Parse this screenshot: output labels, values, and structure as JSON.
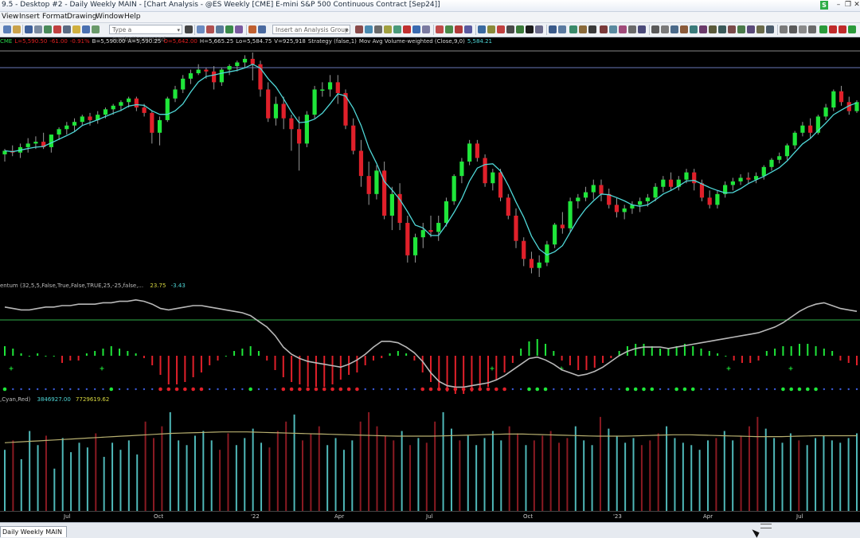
{
  "window": {
    "title": "9.5 - Desktop #2 - Daily Weekly MAIN - [Chart Analysis - @ES Weekly [CME] E-mini S&P 500 Continuous Contract [Sep24]]",
    "badge": "S",
    "minimize_glyph": "–",
    "restore_glyph": "❐",
    "close_glyph": "✕"
  },
  "menu": [
    "View",
    "Insert",
    "Format",
    "Drawing",
    "Window",
    "Help"
  ],
  "toolbar": {
    "command_placeholder": "Type a symbol/command",
    "analysis_group_placeholder": "Insert an Analysis Group",
    "dropdown_glyph": "▾"
  },
  "symbol_bar": {
    "exchange": "CME",
    "last": "L=5,590.50",
    "change": "-61.00",
    "percent": "-0.91%",
    "bid": "B=5,590.00",
    "ask": "A=5,590.25",
    "open": "O=5,642.00",
    "high": "H=5,665.25",
    "low": "Lo=5,584.75",
    "volume": "V=925,918",
    "strategy": "Strategy (false,1)",
    "ma_label": "Mov Avg Volume-weighted (Close,9,0)",
    "ma_value": "5,584.21"
  },
  "indicator": {
    "label": "entum (32,5,5,False,True,False,TRUE,25,-25,false,...",
    "value1": "23.75",
    "value2": "-3.43"
  },
  "volume_indicator": {
    "label": ",Cyan,Red)",
    "value1": "3846927.00",
    "value2": "7729619.62"
  },
  "x_axis": [
    "Jul",
    "Oct",
    "'22",
    "Apr",
    "Jul",
    "Oct",
    "'23",
    "Apr",
    "Jul"
  ],
  "tabs": [
    "Daily Weekly MAIN"
  ],
  "colors": {
    "up": "#1fe63a",
    "down": "#e0202a",
    "ma_line": "#4fd8d8",
    "momentum_line": "#b8b8b8",
    "zero_line": "#2fae48",
    "volume_up": "#4fb8b8",
    "volume_down": "#8a1a22",
    "volume_avg": "#b8b070"
  },
  "chart_data": {
    "type": "candlestick",
    "description_series": "ES weekly OHLC approximation (index units)",
    "candles": [
      {
        "o": 4240,
        "h": 4270,
        "l": 4200,
        "c": 4260
      },
      {
        "o": 4260,
        "h": 4290,
        "l": 4230,
        "c": 4250
      },
      {
        "o": 4250,
        "h": 4300,
        "l": 4220,
        "c": 4280
      },
      {
        "o": 4280,
        "h": 4330,
        "l": 4250,
        "c": 4300
      },
      {
        "o": 4300,
        "h": 4340,
        "l": 4270,
        "c": 4310
      },
      {
        "o": 4310,
        "h": 4360,
        "l": 4270,
        "c": 4280
      },
      {
        "o": 4280,
        "h": 4320,
        "l": 4250,
        "c": 4350
      },
      {
        "o": 4350,
        "h": 4390,
        "l": 4320,
        "c": 4380
      },
      {
        "o": 4380,
        "h": 4420,
        "l": 4350,
        "c": 4400
      },
      {
        "o": 4400,
        "h": 4440,
        "l": 4370,
        "c": 4420
      },
      {
        "o": 4420,
        "h": 4460,
        "l": 4400,
        "c": 4450
      },
      {
        "o": 4450,
        "h": 4470,
        "l": 4400,
        "c": 4430
      },
      {
        "o": 4430,
        "h": 4480,
        "l": 4410,
        "c": 4460
      },
      {
        "o": 4460,
        "h": 4500,
        "l": 4440,
        "c": 4490
      },
      {
        "o": 4490,
        "h": 4520,
        "l": 4460,
        "c": 4510
      },
      {
        "o": 4510,
        "h": 4540,
        "l": 4480,
        "c": 4530
      },
      {
        "o": 4530,
        "h": 4560,
        "l": 4500,
        "c": 4550
      },
      {
        "o": 4550,
        "h": 4560,
        "l": 4480,
        "c": 4500
      },
      {
        "o": 4500,
        "h": 4520,
        "l": 4450,
        "c": 4470
      },
      {
        "o": 4470,
        "h": 4480,
        "l": 4300,
        "c": 4360
      },
      {
        "o": 4360,
        "h": 4450,
        "l": 4290,
        "c": 4430
      },
      {
        "o": 4430,
        "h": 4560,
        "l": 4420,
        "c": 4550
      },
      {
        "o": 4550,
        "h": 4620,
        "l": 4530,
        "c": 4600
      },
      {
        "o": 4600,
        "h": 4680,
        "l": 4580,
        "c": 4660
      },
      {
        "o": 4660,
        "h": 4710,
        "l": 4630,
        "c": 4690
      },
      {
        "o": 4690,
        "h": 4740,
        "l": 4680,
        "c": 4710
      },
      {
        "o": 4710,
        "h": 4720,
        "l": 4660,
        "c": 4700
      },
      {
        "o": 4700,
        "h": 4730,
        "l": 4600,
        "c": 4640
      },
      {
        "o": 4640,
        "h": 4720,
        "l": 4620,
        "c": 4710
      },
      {
        "o": 4710,
        "h": 4740,
        "l": 4680,
        "c": 4730
      },
      {
        "o": 4730,
        "h": 4760,
        "l": 4700,
        "c": 4750
      },
      {
        "o": 4750,
        "h": 4790,
        "l": 4720,
        "c": 4770
      },
      {
        "o": 4770,
        "h": 4805,
        "l": 4650,
        "c": 4740
      },
      {
        "o": 4740,
        "h": 4760,
        "l": 4560,
        "c": 4600
      },
      {
        "o": 4600,
        "h": 4640,
        "l": 4420,
        "c": 4440
      },
      {
        "o": 4440,
        "h": 4560,
        "l": 4400,
        "c": 4520
      },
      {
        "o": 4520,
        "h": 4560,
        "l": 4380,
        "c": 4440
      },
      {
        "o": 4440,
        "h": 4460,
        "l": 4260,
        "c": 4380
      },
      {
        "o": 4380,
        "h": 4450,
        "l": 4150,
        "c": 4300
      },
      {
        "o": 4300,
        "h": 4480,
        "l": 4280,
        "c": 4460
      },
      {
        "o": 4460,
        "h": 4620,
        "l": 4440,
        "c": 4600
      },
      {
        "o": 4600,
        "h": 4640,
        "l": 4560,
        "c": 4600
      },
      {
        "o": 4600,
        "h": 4680,
        "l": 4560,
        "c": 4640
      },
      {
        "o": 4640,
        "h": 4680,
        "l": 4520,
        "c": 4580
      },
      {
        "o": 4580,
        "h": 4600,
        "l": 4380,
        "c": 4400
      },
      {
        "o": 4400,
        "h": 4440,
        "l": 4240,
        "c": 4260
      },
      {
        "o": 4260,
        "h": 4320,
        "l": 4060,
        "c": 4120
      },
      {
        "o": 4120,
        "h": 4200,
        "l": 3960,
        "c": 4020
      },
      {
        "o": 4020,
        "h": 4180,
        "l": 3990,
        "c": 4150
      },
      {
        "o": 4150,
        "h": 4200,
        "l": 3880,
        "c": 3900
      },
      {
        "o": 3900,
        "h": 4060,
        "l": 3820,
        "c": 4020
      },
      {
        "o": 4020,
        "h": 4080,
        "l": 3820,
        "c": 3860
      },
      {
        "o": 3860,
        "h": 3900,
        "l": 3640,
        "c": 3680
      },
      {
        "o": 3680,
        "h": 3800,
        "l": 3640,
        "c": 3780
      },
      {
        "o": 3780,
        "h": 3860,
        "l": 3720,
        "c": 3820
      },
      {
        "o": 3820,
        "h": 3900,
        "l": 3780,
        "c": 3810
      },
      {
        "o": 3810,
        "h": 3900,
        "l": 3760,
        "c": 3860
      },
      {
        "o": 3860,
        "h": 4000,
        "l": 3840,
        "c": 3980
      },
      {
        "o": 3980,
        "h": 4130,
        "l": 3960,
        "c": 4120
      },
      {
        "o": 4120,
        "h": 4220,
        "l": 4080,
        "c": 4200
      },
      {
        "o": 4200,
        "h": 4320,
        "l": 4180,
        "c": 4300
      },
      {
        "o": 4300,
        "h": 4320,
        "l": 4200,
        "c": 4220
      },
      {
        "o": 4220,
        "h": 4240,
        "l": 4060,
        "c": 4080
      },
      {
        "o": 4080,
        "h": 4160,
        "l": 4040,
        "c": 4140
      },
      {
        "o": 4140,
        "h": 4160,
        "l": 3980,
        "c": 4000
      },
      {
        "o": 4000,
        "h": 4020,
        "l": 3880,
        "c": 3900
      },
      {
        "o": 3900,
        "h": 3940,
        "l": 3720,
        "c": 3760
      },
      {
        "o": 3760,
        "h": 3780,
        "l": 3620,
        "c": 3660
      },
      {
        "o": 3660,
        "h": 3700,
        "l": 3580,
        "c": 3610
      },
      {
        "o": 3610,
        "h": 3680,
        "l": 3560,
        "c": 3640
      },
      {
        "o": 3640,
        "h": 3760,
        "l": 3620,
        "c": 3740
      },
      {
        "o": 3740,
        "h": 3860,
        "l": 3720,
        "c": 3850
      },
      {
        "o": 3850,
        "h": 3920,
        "l": 3800,
        "c": 3830
      },
      {
        "o": 3830,
        "h": 4000,
        "l": 3810,
        "c": 3980
      },
      {
        "o": 3980,
        "h": 4020,
        "l": 3940,
        "c": 4000
      },
      {
        "o": 4000,
        "h": 4060,
        "l": 3980,
        "c": 4030
      },
      {
        "o": 4030,
        "h": 4100,
        "l": 3990,
        "c": 4070
      },
      {
        "o": 4070,
        "h": 4100,
        "l": 3980,
        "c": 4020
      },
      {
        "o": 4020,
        "h": 4050,
        "l": 3940,
        "c": 3960
      },
      {
        "o": 3960,
        "h": 4000,
        "l": 3890,
        "c": 3920
      },
      {
        "o": 3920,
        "h": 3960,
        "l": 3880,
        "c": 3940
      },
      {
        "o": 3940,
        "h": 3980,
        "l": 3910,
        "c": 3960
      },
      {
        "o": 3960,
        "h": 4000,
        "l": 3920,
        "c": 3980
      },
      {
        "o": 3980,
        "h": 4020,
        "l": 3950,
        "c": 4000
      },
      {
        "o": 4000,
        "h": 4080,
        "l": 3980,
        "c": 4060
      },
      {
        "o": 4060,
        "h": 4120,
        "l": 4030,
        "c": 4100
      },
      {
        "o": 4100,
        "h": 4140,
        "l": 4040,
        "c": 4060
      },
      {
        "o": 4060,
        "h": 4120,
        "l": 4040,
        "c": 4100
      },
      {
        "o": 4100,
        "h": 4160,
        "l": 4080,
        "c": 4140
      },
      {
        "o": 4140,
        "h": 4160,
        "l": 4040,
        "c": 4080
      },
      {
        "o": 4080,
        "h": 4100,
        "l": 3980,
        "c": 4000
      },
      {
        "o": 4000,
        "h": 4040,
        "l": 3940,
        "c": 3960
      },
      {
        "o": 3960,
        "h": 4040,
        "l": 3940,
        "c": 4020
      },
      {
        "o": 4020,
        "h": 4090,
        "l": 4000,
        "c": 4070
      },
      {
        "o": 4070,
        "h": 4110,
        "l": 4040,
        "c": 4090
      },
      {
        "o": 4090,
        "h": 4130,
        "l": 4070,
        "c": 4110
      },
      {
        "o": 4110,
        "h": 4140,
        "l": 4080,
        "c": 4100
      },
      {
        "o": 4100,
        "h": 4140,
        "l": 4080,
        "c": 4120
      },
      {
        "o": 4120,
        "h": 4180,
        "l": 4100,
        "c": 4170
      },
      {
        "o": 4170,
        "h": 4220,
        "l": 4150,
        "c": 4210
      },
      {
        "o": 4210,
        "h": 4250,
        "l": 4190,
        "c": 4230
      },
      {
        "o": 4230,
        "h": 4300,
        "l": 4210,
        "c": 4290
      },
      {
        "o": 4290,
        "h": 4370,
        "l": 4270,
        "c": 4360
      },
      {
        "o": 4360,
        "h": 4420,
        "l": 4340,
        "c": 4400
      },
      {
        "o": 4400,
        "h": 4440,
        "l": 4330,
        "c": 4360
      },
      {
        "o": 4360,
        "h": 4460,
        "l": 4350,
        "c": 4450
      },
      {
        "o": 4450,
        "h": 4520,
        "l": 4430,
        "c": 4500
      },
      {
        "o": 4500,
        "h": 4600,
        "l": 4480,
        "c": 4590
      },
      {
        "o": 4590,
        "h": 4620,
        "l": 4510,
        "c": 4530
      },
      {
        "o": 4530,
        "h": 4560,
        "l": 4460,
        "c": 4480
      },
      {
        "o": 4480,
        "h": 4540,
        "l": 4470,
        "c": 4530
      }
    ],
    "momentum_line": [
      58,
      57,
      56,
      56,
      57,
      58,
      58,
      59,
      59,
      60,
      60,
      60,
      61,
      61,
      62,
      62,
      63,
      62,
      60,
      57,
      56,
      57,
      58,
      59,
      59,
      58,
      57,
      56,
      55,
      54,
      52,
      48,
      44,
      38,
      30,
      25,
      22,
      20,
      19,
      18,
      17,
      16,
      18,
      21,
      25,
      30,
      34,
      34,
      33,
      30,
      26,
      20,
      12,
      6,
      3,
      2,
      2,
      3,
      4,
      5,
      7,
      10,
      14,
      18,
      22,
      23,
      21,
      18,
      14,
      12,
      10,
      11,
      13,
      16,
      20,
      24,
      27,
      29,
      30,
      30,
      30,
      29,
      30,
      31,
      32,
      33,
      34,
      35,
      36,
      37,
      38,
      39,
      40,
      42,
      44,
      47,
      51,
      55,
      58,
      60,
      61,
      59,
      57,
      56,
      55
    ],
    "momentum_hist": [
      4,
      3,
      1,
      0,
      1,
      0,
      0,
      -3,
      -2,
      -2,
      1,
      2,
      3,
      4,
      3,
      2,
      1,
      -1,
      -4,
      -8,
      -12,
      -12,
      -11,
      -9,
      -7,
      -4,
      -2,
      0,
      2,
      3,
      4,
      2,
      -2,
      -6,
      -9,
      -11,
      -12,
      -13,
      -13,
      -13,
      -12,
      -10,
      -8,
      -7,
      -4,
      -2,
      -1,
      1,
      2,
      1,
      -2,
      -7,
      -11,
      -14,
      -15,
      -16,
      -16,
      -15,
      -14,
      -13,
      -10,
      -7,
      -3,
      3,
      6,
      7,
      5,
      2,
      -2,
      -4,
      -6,
      -6,
      -5,
      -3,
      -1,
      2,
      4,
      5,
      5,
      4,
      3,
      3,
      4,
      5,
      4,
      3,
      2,
      1,
      0,
      -2,
      -3,
      -3,
      -2,
      2,
      3,
      4,
      4,
      5,
      5,
      4,
      3,
      2,
      -2,
      -3,
      -4
    ],
    "volume": [
      260,
      300,
      220,
      340,
      280,
      320,
      180,
      310,
      250,
      290,
      270,
      330,
      230,
      290,
      260,
      300,
      240,
      380,
      310,
      360,
      420,
      300,
      280,
      320,
      340,
      300,
      260,
      330,
      280,
      310,
      350,
      290,
      270,
      340,
      380,
      410,
      300,
      330,
      360,
      280,
      310,
      260,
      300,
      380,
      420,
      360,
      320,
      300,
      340,
      280,
      310,
      290,
      380,
      420,
      350,
      300,
      320,
      280,
      310,
      340,
      300,
      360,
      330,
      280,
      300,
      320,
      340,
      290,
      310,
      360,
      300,
      280,
      400,
      350,
      320,
      290,
      310,
      280,
      300,
      330,
      360,
      310,
      290,
      280,
      260,
      300,
      310,
      340,
      300,
      320,
      360,
      400,
      350,
      310,
      290,
      330,
      300,
      280,
      310,
      320,
      300,
      290,
      310,
      330
    ],
    "volume_avg": [
      290,
      292,
      294,
      296,
      298,
      300,
      302,
      304,
      306,
      308,
      310,
      312,
      314,
      316,
      318,
      320,
      322,
      324,
      326,
      328,
      330,
      331,
      332,
      333,
      334,
      335,
      336,
      336,
      336,
      336,
      335,
      334,
      333,
      332,
      331,
      330,
      329,
      328,
      327,
      326,
      325,
      324,
      323,
      322,
      321,
      320,
      319,
      318,
      318,
      318,
      318,
      318,
      319,
      320,
      321,
      322,
      323,
      324,
      325,
      326,
      327,
      327,
      327,
      326,
      325,
      324,
      323,
      322,
      321,
      320,
      319,
      318,
      318,
      318,
      318,
      319,
      320,
      321,
      322,
      323,
      324,
      324,
      324,
      323,
      322,
      321,
      320,
      319,
      318,
      317,
      316,
      316,
      316,
      316,
      317,
      318,
      319,
      320,
      320,
      320,
      320,
      320,
      320
    ]
  }
}
